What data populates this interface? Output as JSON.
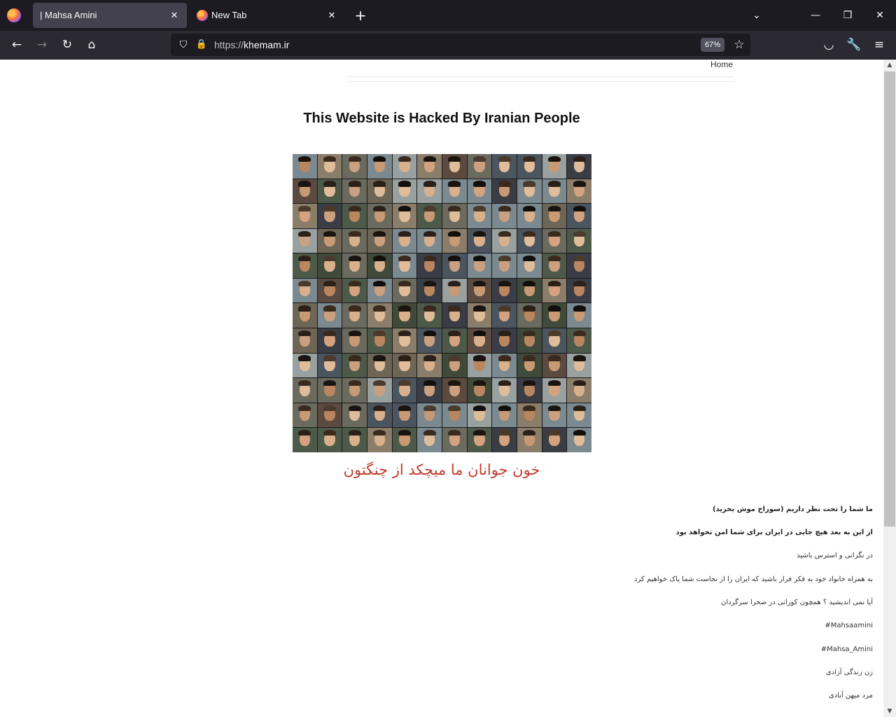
{
  "browser": {
    "tabs": [
      {
        "title": "| Mahsa Amini",
        "active": true
      },
      {
        "title": "New Tab",
        "active": false
      }
    ],
    "new_tab_symbol": "+",
    "url_protocol": "https://",
    "url_host": "khemam.ir",
    "zoom": "67%",
    "icons": {
      "back": "←",
      "forward": "→",
      "reload": "↻",
      "home": "⌂",
      "shield": "⛉",
      "lock": "🔒",
      "star": "☆",
      "pocket": "◡",
      "tools": "🔧",
      "menu": "≡",
      "close": "✕",
      "list_tabs": "⌄",
      "minimize": "—",
      "restore": "❐"
    }
  },
  "page": {
    "nav": {
      "home_label": "Home"
    },
    "headline": "This Website is Hacked By Iranian People",
    "slogan": "خون جوانان ما میچکد از چنگتون",
    "messages": [
      {
        "text": "ما شما را تحت نظر داریم (سوراخ موش بخرید)",
        "bold": true
      },
      {
        "text": "از این به بعد هیچ جایی در ایران برای شما امن نخواهد بود",
        "bold": true
      },
      {
        "text": "در نگرانی و استرس باشید",
        "bold": false
      },
      {
        "text": "به همراه خانواد خود به فکر فرار باشید که ایران را از نجاست شما پاک خواهیم کرد",
        "bold": false
      },
      {
        "text": "آیا نمی اندیشید ؟ همچون کورانی در صحرا سرگردان",
        "bold": false
      },
      {
        "text": "Mahsaamini#",
        "bold": false
      },
      {
        "text": "Mahsa_Amini#",
        "bold": false
      },
      {
        "text": "زن زندگی آزادی",
        "bold": false
      },
      {
        "text": "مرد میهن آبادی",
        "bold": false
      }
    ]
  },
  "colors": {
    "tabbar_bg": "#1c1b22",
    "navbar_bg": "#2b2a33",
    "slogan_red": "#c0392b"
  }
}
